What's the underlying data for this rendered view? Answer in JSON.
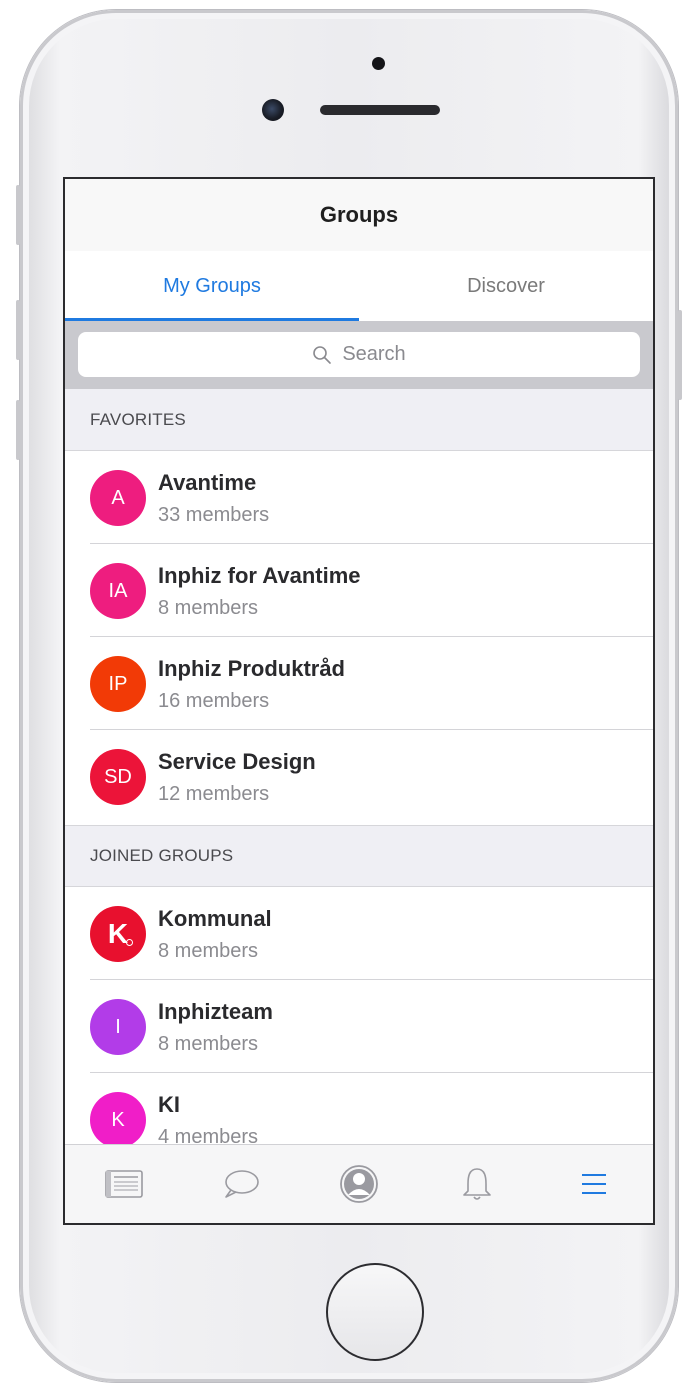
{
  "navbar": {
    "title": "Groups"
  },
  "tabs": [
    {
      "label": "My Groups",
      "active": true
    },
    {
      "label": "Discover",
      "active": false
    }
  ],
  "search": {
    "placeholder": "Search"
  },
  "sections": {
    "favorites": {
      "header": "FAVORITES",
      "groups": [
        {
          "initials": "A",
          "name": "Avantime",
          "members": "33 members",
          "color": "#ee1d7f"
        },
        {
          "initials": "IA",
          "name": "Inphiz for Avantime",
          "members": "8 members",
          "color": "#ee1d7f"
        },
        {
          "initials": "IP",
          "name": "Inphiz Produktråd",
          "members": "16 members",
          "color": "#f23a06"
        },
        {
          "initials": "SD",
          "name": "Service Design",
          "members": "12 members",
          "color": "#ec1439"
        }
      ]
    },
    "joined": {
      "header": "JOINED GROUPS",
      "groups": [
        {
          "initials": "K",
          "name": "Kommunal",
          "members": "8 members",
          "color": "#e8102e",
          "logo": true
        },
        {
          "initials": "I",
          "name": "Inphizteam",
          "members": "8 members",
          "color": "#b23ce8"
        },
        {
          "initials": "K",
          "name": "KI",
          "members": "4 members",
          "color": "#f01ec8"
        }
      ]
    }
  },
  "tabbar": [
    {
      "icon": "news-feed-icon"
    },
    {
      "icon": "chat-bubble-icon"
    },
    {
      "icon": "profile-icon"
    },
    {
      "icon": "bell-icon"
    },
    {
      "icon": "menu-icon",
      "active": true
    }
  ],
  "colors": {
    "accent": "#1f7ae0",
    "section_bg": "#efeff4",
    "search_bar_bg": "#c9c9ce"
  }
}
